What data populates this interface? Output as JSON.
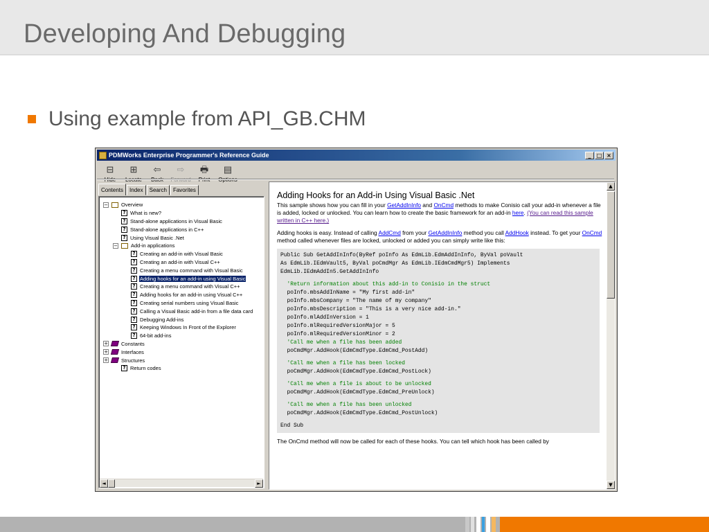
{
  "slide": {
    "title": "Developing And Debugging",
    "bullet": "Using example from API_GB.CHM"
  },
  "window": {
    "title": "PDMWorks Enterprise Programmer's Reference Guide",
    "controls": {
      "minimize": "_",
      "maximize": "□",
      "close": "×"
    },
    "toolbar": [
      {
        "label": "Hide",
        "icon": "hide-icon",
        "glyph": "⊟",
        "enabled": true
      },
      {
        "label": "Locate",
        "icon": "locate-icon",
        "glyph": "⊞",
        "enabled": true
      },
      {
        "label": "Back",
        "icon": "back-arrow-icon",
        "glyph": "⇦",
        "enabled": true
      },
      {
        "label": "Forward",
        "icon": "forward-arrow-icon",
        "glyph": "⇨",
        "enabled": false
      },
      {
        "label": "Print",
        "icon": "printer-icon",
        "glyph": "🖶",
        "enabled": true
      },
      {
        "label": "Options",
        "icon": "options-icon",
        "glyph": "▤",
        "enabled": true
      }
    ]
  },
  "tabs": [
    {
      "label": "Contents",
      "active": true
    },
    {
      "label": "Index",
      "active": false
    },
    {
      "label": "Search",
      "active": false
    },
    {
      "label": "Favorites",
      "active": false
    }
  ],
  "tree": [
    {
      "level": 0,
      "expander": "−",
      "icon": "open-book-icon",
      "label": "Overview"
    },
    {
      "level": 1,
      "icon": "help-page-icon",
      "label": "What is new?"
    },
    {
      "level": 1,
      "icon": "help-page-icon",
      "label": "Stand-alone applications in Visual Basic"
    },
    {
      "level": 1,
      "icon": "help-page-icon",
      "label": "Stand-alone applications in C++"
    },
    {
      "level": 1,
      "icon": "help-page-icon",
      "label": "Using Visual Basic .Net"
    },
    {
      "level": 1,
      "expander": "−",
      "icon": "open-book-icon",
      "label": "Add-in applications"
    },
    {
      "level": 2,
      "icon": "help-page-icon",
      "label": "Creating an add-in with Visual Basic"
    },
    {
      "level": 2,
      "icon": "help-page-icon",
      "label": "Creating an add-in with Visual C++"
    },
    {
      "level": 2,
      "icon": "help-page-icon",
      "label": "Creating a menu command with Visual Basic"
    },
    {
      "level": 2,
      "icon": "help-page-icon",
      "label": "Adding hooks for an add-in using Visual Basic",
      "selected": true
    },
    {
      "level": 2,
      "icon": "help-page-icon",
      "label": "Creating a menu command with Visual C++"
    },
    {
      "level": 2,
      "icon": "help-page-icon",
      "label": "Adding hooks for an add-in using Visual C++"
    },
    {
      "level": 2,
      "icon": "help-page-icon",
      "label": "Creating serial numbers using Visual Basic"
    },
    {
      "level": 2,
      "icon": "help-page-icon",
      "label": "Calling a Visual Basic add-in from a file data card"
    },
    {
      "level": 2,
      "icon": "help-page-icon",
      "label": "Debugging Add-ins"
    },
    {
      "level": 2,
      "icon": "help-page-icon",
      "label": "Keeping Windows In Front of the Explorer"
    },
    {
      "level": 2,
      "icon": "help-page-icon",
      "label": "64-bit add-ins"
    },
    {
      "level": 0,
      "expander": "+",
      "icon": "purple-book-icon",
      "label": "Constants"
    },
    {
      "level": 0,
      "expander": "+",
      "icon": "purple-book-icon",
      "label": "Interfaces"
    },
    {
      "level": 0,
      "expander": "+",
      "icon": "purple-book-icon",
      "label": "Structures"
    },
    {
      "level": 1,
      "icon": "help-page-icon",
      "label": "Return codes"
    }
  ],
  "topic": {
    "title": "Adding Hooks for an Add-in Using Visual Basic .Net",
    "para1": {
      "t1": "This sample shows how you can fill in your ",
      "l1": "GetAddInInfo",
      "t2": " and ",
      "l2": "OnCmd",
      "t3": " methods to make Conisio call your add-in whenever a file is added, locked or unlocked. You can learn how to create the basic framework for an add-in ",
      "l3": "here",
      "t4": ". ",
      "l4": "(You can read this sample written in C++ here.)"
    },
    "para2": {
      "t1": "Adding hooks is easy. Instead of calling ",
      "l1": "AddCmd",
      "t2": " from your ",
      "l2": "GetAddInInfo",
      "t3": " method you call ",
      "l3": "AddHook",
      "t4": " instead. To get your ",
      "l4": "OnCmd",
      "t5": " method called whenever files are locked, unlocked or added you can simply write like this:"
    },
    "code": [
      {
        "text": "Public Sub GetAddInInfo(ByRef poInfo As EdmLib.EdmAddInInfo, ByVal poVault",
        "type": "code"
      },
      {
        "text": "As EdmLib.IEdmVault5, ByVal poCmdMgr As EdmLib.IEdmCmdMgr5) Implements",
        "type": "code"
      },
      {
        "text": "EdmLib.IEdmAddIn5.GetAddInInfo",
        "type": "code"
      },
      {
        "text": "",
        "type": "blank"
      },
      {
        "text": "  'Return information about this add-in to Conisio in the struct",
        "type": "comment"
      },
      {
        "text": "  poInfo.mbsAddInName = \"My first add-in\"",
        "type": "code"
      },
      {
        "text": "  poInfo.mbsCompany = \"The name of my company\"",
        "type": "code"
      },
      {
        "text": "  poInfo.mbsDescription = \"This is a very nice add-in.\"",
        "type": "code"
      },
      {
        "text": "  poInfo.mlAddInVersion = 1",
        "type": "code"
      },
      {
        "text": "  poInfo.mlRequiredVersionMajor = 5",
        "type": "code"
      },
      {
        "text": "  poInfo.mlRequiredVersionMinor = 2",
        "type": "code"
      },
      {
        "text": "  'Call me when a file has been added",
        "type": "comment"
      },
      {
        "text": "  poCmdMgr.AddHook(EdmCmdType.EdmCmd_PostAdd)",
        "type": "code"
      },
      {
        "text": "",
        "type": "blank"
      },
      {
        "text": "  'Call me when a file has been locked",
        "type": "comment"
      },
      {
        "text": "  poCmdMgr.AddHook(EdmCmdType.EdmCmd_PostLock)",
        "type": "code"
      },
      {
        "text": "",
        "type": "blank"
      },
      {
        "text": "  'Call me when a file is about to be unlocked",
        "type": "comment"
      },
      {
        "text": "  poCmdMgr.AddHook(EdmCmdType.EdmCmd_PreUnlock)",
        "type": "code"
      },
      {
        "text": "",
        "type": "blank"
      },
      {
        "text": "  'Call me when a file has been unlocked",
        "type": "comment"
      },
      {
        "text": "  poCmdMgr.AddHook(EdmCmdType.EdmCmd_PostUnlock)",
        "type": "code"
      },
      {
        "text": "",
        "type": "blank"
      },
      {
        "text": "End Sub",
        "type": "code"
      }
    ],
    "tail": "The OnCmd method will now be called for each of these hooks. You can tell which hook has been called by"
  },
  "scroll": {
    "up": "▲",
    "down": "▼",
    "left": "◄",
    "right": "►"
  },
  "colors": {
    "accent": "#f07800",
    "titlebar": "#0a246a",
    "link": "#0000ee",
    "comment": "#008000",
    "footer_gray": "#b2b2b2"
  }
}
